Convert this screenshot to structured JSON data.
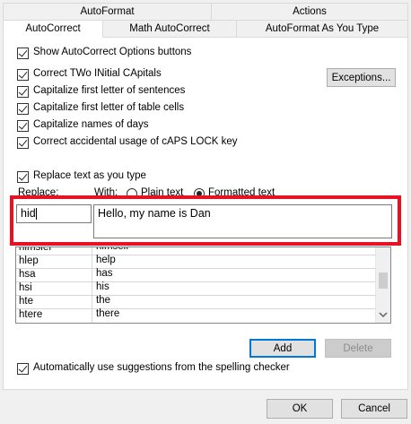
{
  "tabs_back": [
    {
      "label": "AutoFormat"
    },
    {
      "label": "Actions"
    }
  ],
  "tabs_front": [
    {
      "label": "AutoCorrect"
    },
    {
      "label": "Math AutoCorrect"
    },
    {
      "label": "AutoFormat As You Type"
    }
  ],
  "show_buttons": {
    "label": "Show AutoCorrect Options buttons",
    "checked": true
  },
  "options": [
    {
      "label": "Correct TWo INitial CApitals",
      "checked": true
    },
    {
      "label": "Capitalize first letter of sentences",
      "checked": true
    },
    {
      "label": "Capitalize first letter of table cells",
      "checked": true
    },
    {
      "label": "Capitalize names of days",
      "checked": true
    },
    {
      "label": "Correct accidental usage of cAPS LOCK key",
      "checked": true
    }
  ],
  "exceptions_button": "Exceptions...",
  "replace_as_you_type": {
    "label": "Replace text as you type",
    "checked": true
  },
  "replace_label": "Replace:",
  "with_label": "With:",
  "plain_text_label": "Plain text",
  "formatted_text_label": "Formatted text",
  "replace_value": "hid",
  "with_value": "Hello, my name is Dan",
  "entries": [
    {
      "replace": "hlmslef",
      "with": "himself"
    },
    {
      "replace": "hlep",
      "with": "help"
    },
    {
      "replace": "hsa",
      "with": "has"
    },
    {
      "replace": "hsi",
      "with": "his"
    },
    {
      "replace": "hte",
      "with": "the"
    },
    {
      "replace": "htere",
      "with": "there"
    }
  ],
  "add_button": "Add",
  "delete_button": "Delete",
  "spelling_suggestions": {
    "label": "Automatically use suggestions from the spelling checker",
    "checked": true
  },
  "ok_button": "OK",
  "cancel_button": "Cancel",
  "highlight_color": "#e81123"
}
